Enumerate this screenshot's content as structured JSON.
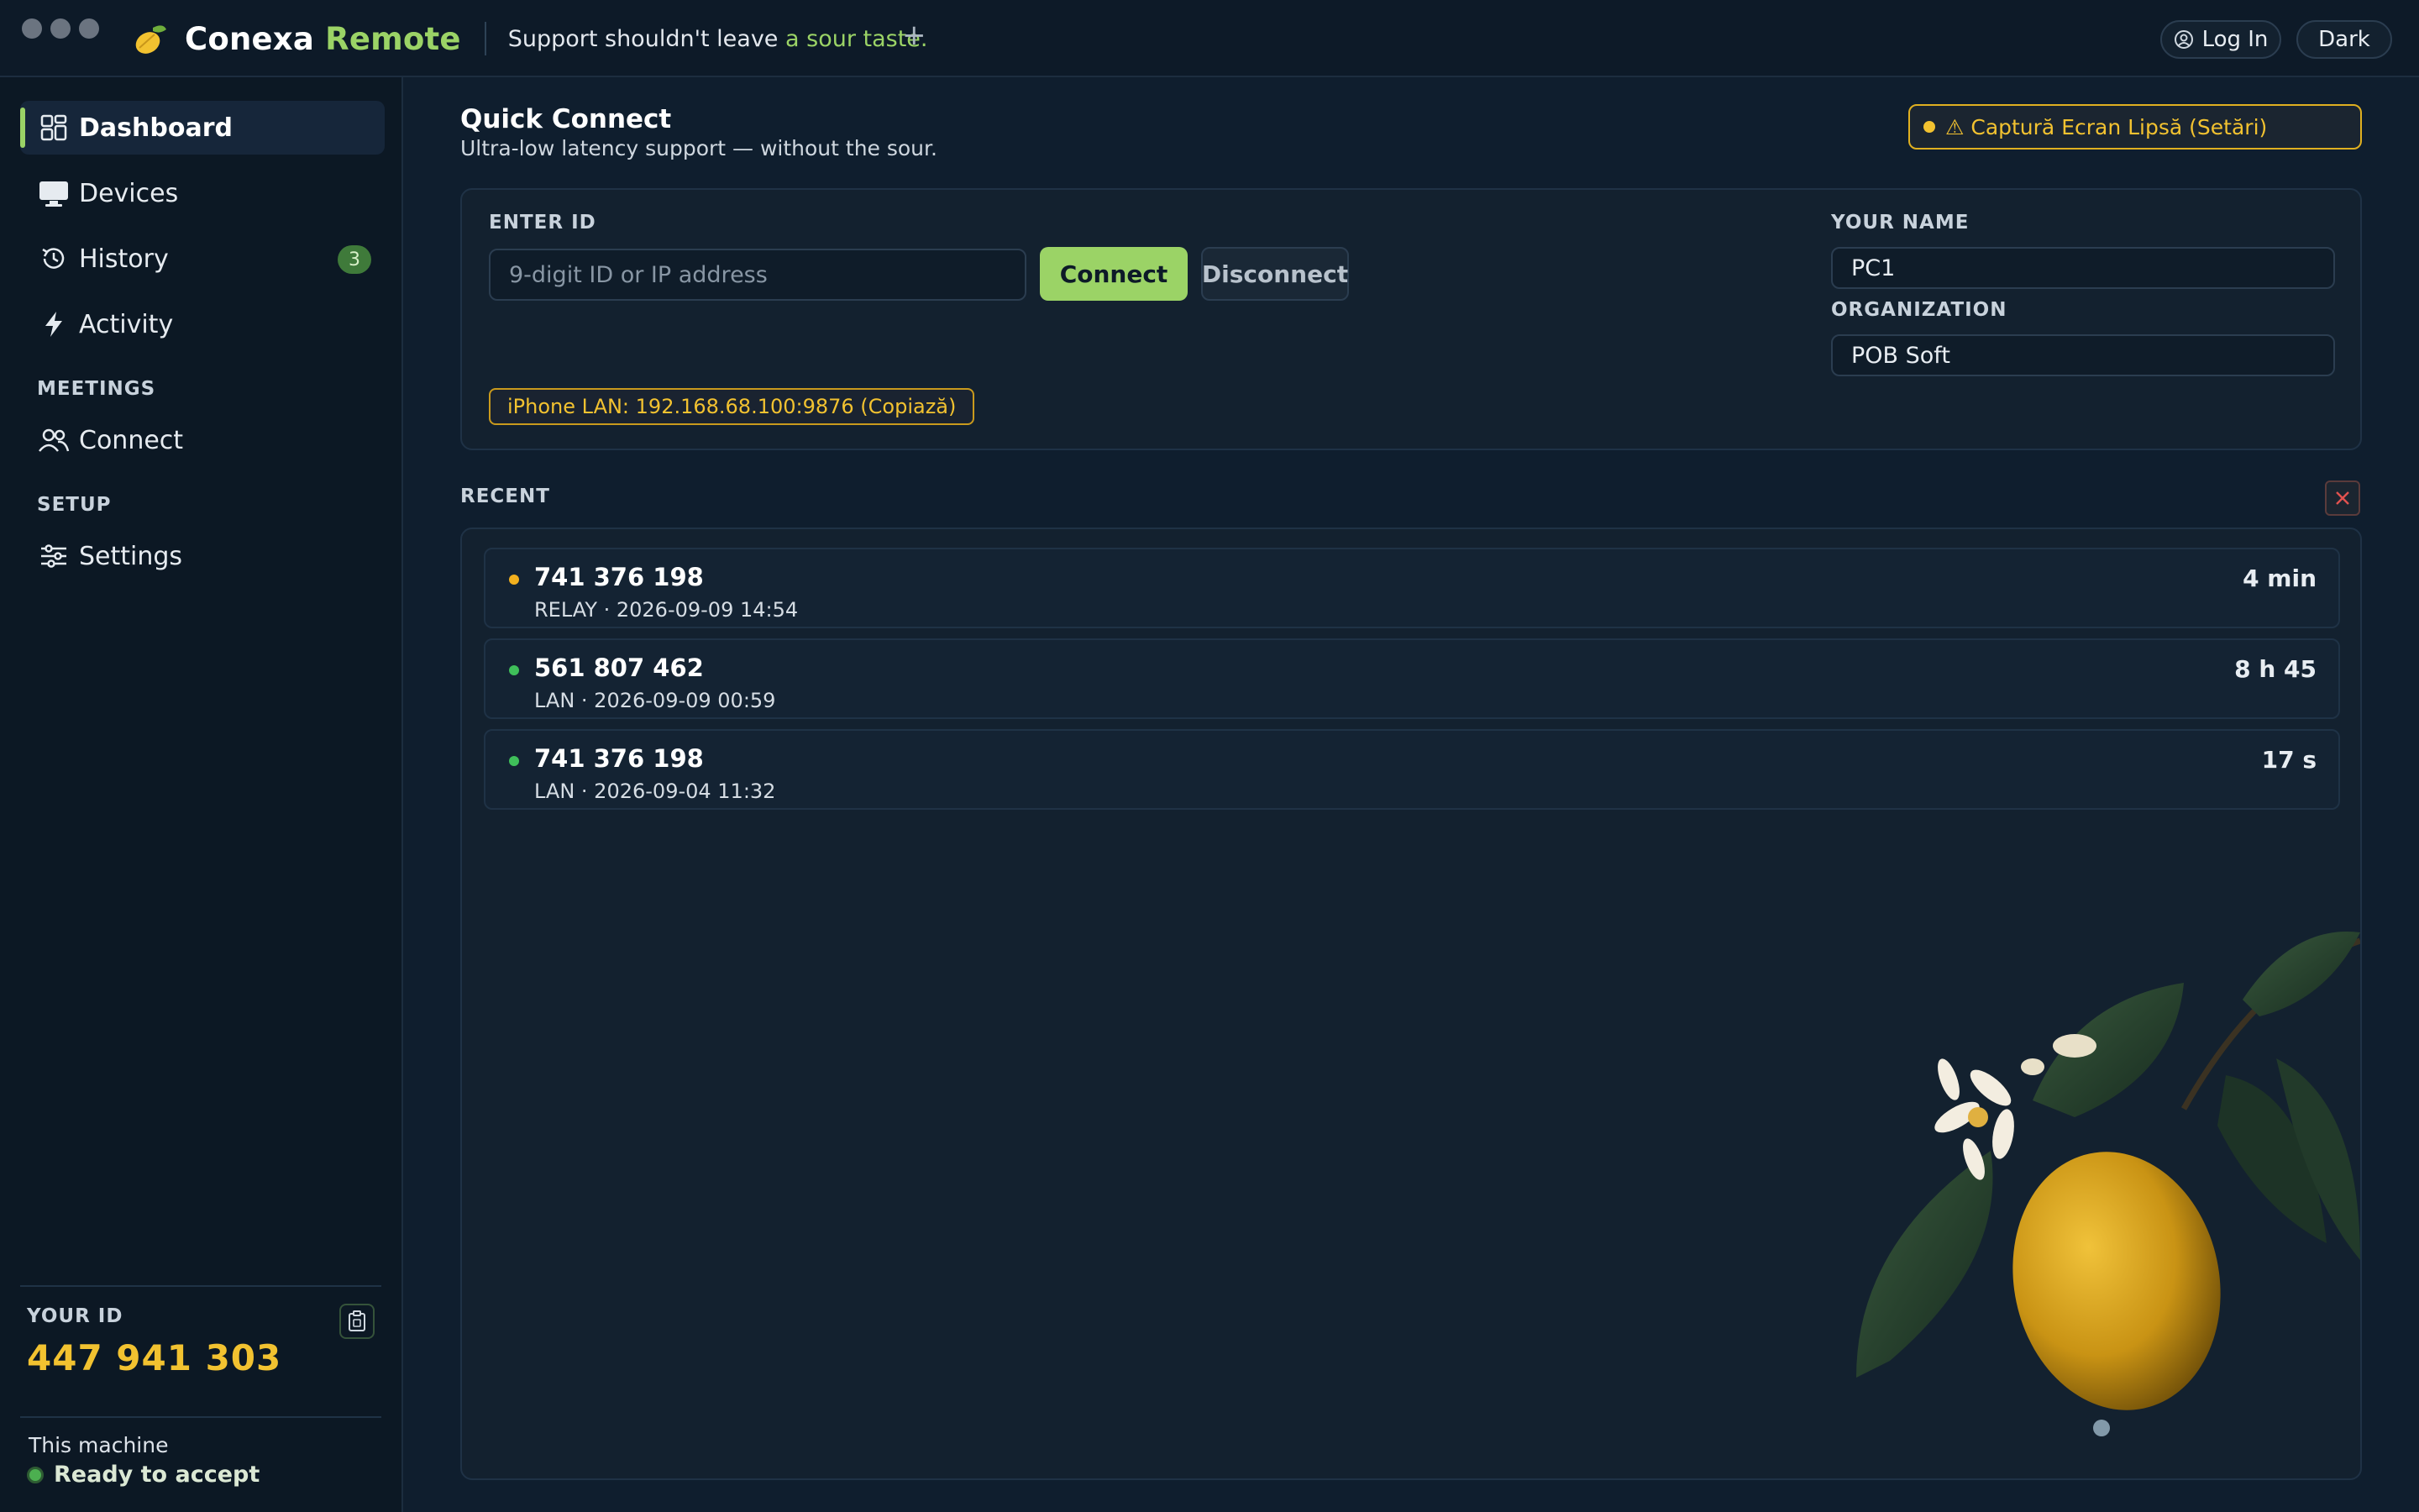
{
  "app": {
    "brand_primary": "Conexa",
    "brand_accent": "Remote",
    "tagline_prefix": "Support shouldn't leave",
    "tagline_accent": "a sour taste.",
    "new_tab_symbol": "+",
    "login_label": "Log In",
    "theme_label": "Dark",
    "accent_color": "#9bd366",
    "warning_color": "#f2c230"
  },
  "sidebar": {
    "items": [
      {
        "label": "Dashboard",
        "icon": "dashboard-grid-icon",
        "active": true
      },
      {
        "label": "Devices",
        "icon": "monitor-icon"
      },
      {
        "label": "History",
        "icon": "history-clock-icon",
        "badge": "3"
      },
      {
        "label": "Activity",
        "icon": "bolt-icon"
      }
    ],
    "section_meetings": "MEETINGS",
    "meetings_items": [
      {
        "label": "Connect",
        "icon": "users-icon"
      }
    ],
    "section_setup": "SETUP",
    "setup_items": [
      {
        "label": "Settings",
        "icon": "sliders-icon"
      }
    ],
    "your_id_label": "YOUR ID",
    "your_id_value": "447 941 303",
    "machine_label": "This machine",
    "machine_status": "Ready to accept"
  },
  "quick_connect": {
    "title": "Quick Connect",
    "subtitle": "Ultra-low latency support — without the sour.",
    "warning": "⚠ Captură Ecran Lipsă (Setări)",
    "enter_id_label": "ENTER ID",
    "id_placeholder": "9-digit ID or IP address",
    "connect_label": "Connect",
    "disconnect_label": "Disconnect",
    "lan_info": "iPhone LAN: 192.168.68.100:9876  (Copiază)",
    "your_name_label": "YOUR NAME",
    "your_name_value": "PC1",
    "organization_label": "ORGANIZATION",
    "organization_value": "POB Soft"
  },
  "recent": {
    "label": "RECENT",
    "rows": [
      {
        "id": "741 376 198",
        "meta": "RELAY  ·  2026-09-09 14:54",
        "duration": "4 min",
        "status_color": "#f2b01e"
      },
      {
        "id": "561 807 462",
        "meta": "LAN  ·  2026-09-09 00:59",
        "duration": "8 h 45",
        "status_color": "#3fbf5a"
      },
      {
        "id": "741 376 198",
        "meta": "LAN  ·  2026-09-04 11:32",
        "duration": "17 s",
        "status_color": "#3fbf5a"
      }
    ]
  }
}
